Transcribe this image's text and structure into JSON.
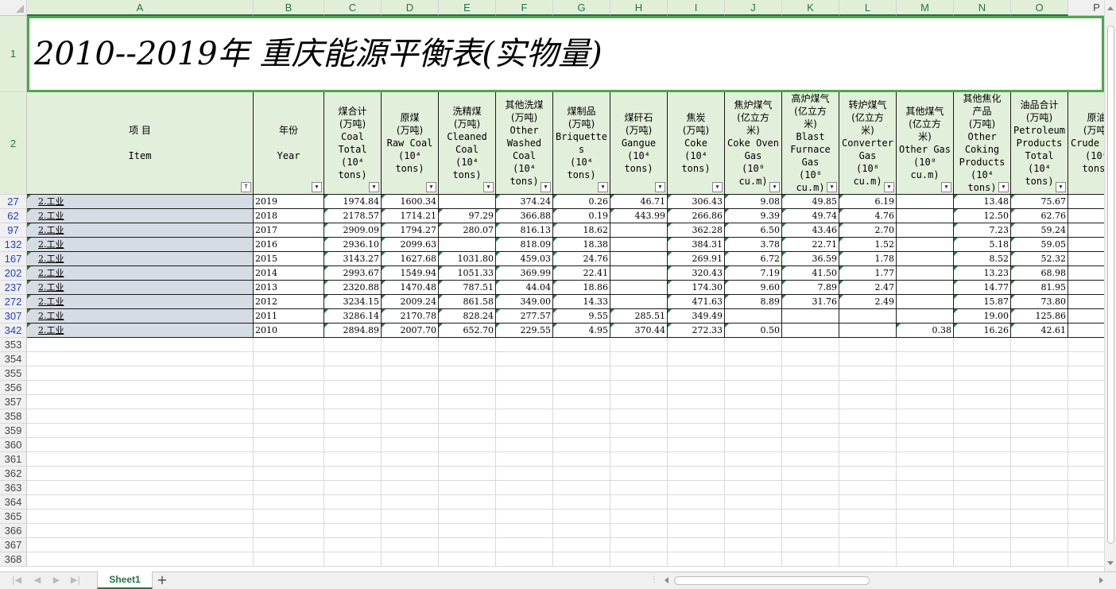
{
  "colors": {
    "accent": "#217346",
    "header_fill": "#e2efda",
    "item_fill": "#d6dce4",
    "filtered_row": "#1c3fd0",
    "title_border": "#4aa94a"
  },
  "columns": [
    "A",
    "B",
    "C",
    "D",
    "E",
    "F",
    "G",
    "H",
    "I",
    "J",
    "K",
    "L",
    "M",
    "N",
    "O",
    "P"
  ],
  "title": "2010--2019年  重庆能源平衡表(实物量)",
  "header_rows": {
    "title_row": "1",
    "header_row": "2"
  },
  "headers": [
    {
      "lines": [
        "项 目",
        "",
        "Item"
      ]
    },
    {
      "lines": [
        "年份",
        "",
        "Year"
      ]
    },
    {
      "lines": [
        "煤合计",
        "(万吨)",
        "Coal",
        "Total",
        "(10⁴",
        "tons)"
      ]
    },
    {
      "lines": [
        "原煤",
        "(万吨)",
        "Raw Coal",
        "(10⁴",
        "tons)"
      ]
    },
    {
      "lines": [
        "洗精煤",
        "(万吨)",
        "Cleaned",
        "Coal",
        "(10⁴",
        "tons)"
      ]
    },
    {
      "lines": [
        "其他洗煤",
        "(万吨)",
        "Other",
        "Washed",
        "Coal",
        "(10⁴",
        "tons)"
      ]
    },
    {
      "lines": [
        "煤制品",
        "(万吨)",
        "Briquette",
        "s",
        "(10⁴",
        "tons)"
      ]
    },
    {
      "lines": [
        "煤矸石",
        "(万吨)",
        "Gangue",
        "(10⁴",
        "tons)"
      ]
    },
    {
      "lines": [
        "焦炭",
        "(万吨)",
        "Coke",
        "(10⁴",
        "tons)"
      ]
    },
    {
      "lines": [
        "焦炉煤气",
        "(亿立方",
        "米)",
        "Coke Oven",
        "Gas",
        "(10⁸",
        "cu.m)"
      ]
    },
    {
      "lines": [
        "高炉煤气",
        "(亿立方",
        "米)",
        "Blast",
        "Furnace",
        "Gas",
        "(10⁸",
        "cu.m)"
      ]
    },
    {
      "lines": [
        "转炉煤气",
        "(亿立方",
        "米)",
        "Converter",
        "Gas",
        "(10⁸",
        "cu.m)"
      ]
    },
    {
      "lines": [
        "其他煤气",
        "(亿立方",
        "米)",
        "Other Gas",
        "(10⁸",
        "cu.m)"
      ]
    },
    {
      "lines": [
        "其他焦化",
        "产品",
        "(万吨)",
        "Other",
        "Coking",
        "Products",
        "(10⁴",
        "tons)"
      ]
    },
    {
      "lines": [
        "油品合计",
        "(万吨)",
        "Petroleum",
        "Products",
        "Total",
        "(10⁴",
        "tons)"
      ]
    },
    {
      "lines": [
        "原油",
        "(万吨)",
        "Crude Oil",
        "(10⁴",
        "tons)"
      ]
    }
  ],
  "rows": [
    {
      "num": "27",
      "item": "2.工业",
      "year": "2019",
      "vals": [
        "1974.84",
        "1600.34",
        "",
        "374.24",
        "0.26",
        "46.71",
        "306.43",
        "9.08",
        "49.85",
        "6.19",
        "",
        "13.48",
        "75.67"
      ]
    },
    {
      "num": "62",
      "item": "2.工业",
      "year": "2018",
      "vals": [
        "2178.57",
        "1714.21",
        "97.29",
        "366.88",
        "0.19",
        "443.99",
        "266.86",
        "9.39",
        "49.74",
        "4.76",
        "",
        "12.50",
        "62.76"
      ]
    },
    {
      "num": "97",
      "item": "2.工业",
      "year": "2017",
      "vals": [
        "2909.09",
        "1794.27",
        "280.07",
        "816.13",
        "18.62",
        "",
        "362.28",
        "6.50",
        "43.46",
        "2.70",
        "",
        "7.23",
        "59.24"
      ]
    },
    {
      "num": "132",
      "item": "2.工业",
      "year": "2016",
      "vals": [
        "2936.10",
        "2099.63",
        "",
        "818.09",
        "18.38",
        "",
        "384.31",
        "3.78",
        "22.71",
        "1.52",
        "",
        "5.18",
        "59.05"
      ]
    },
    {
      "num": "167",
      "item": "2.工业",
      "year": "2015",
      "vals": [
        "3143.27",
        "1627.68",
        "1031.80",
        "459.03",
        "24.76",
        "",
        "269.91",
        "6.72",
        "36.59",
        "1.78",
        "",
        "8.52",
        "52.32"
      ]
    },
    {
      "num": "202",
      "item": "2.工业",
      "year": "2014",
      "vals": [
        "2993.67",
        "1549.94",
        "1051.33",
        "369.99",
        "22.41",
        "",
        "320.43",
        "7.19",
        "41.50",
        "1.77",
        "",
        "13.23",
        "68.98"
      ]
    },
    {
      "num": "237",
      "item": "2.工业",
      "year": "2013",
      "vals": [
        "2320.88",
        "1470.48",
        "787.51",
        "44.04",
        "18.86",
        "",
        "174.30",
        "9.60",
        "7.89",
        "2.47",
        "",
        "14.77",
        "81.95"
      ]
    },
    {
      "num": "272",
      "item": "2.工业",
      "year": "2012",
      "vals": [
        "3234.15",
        "2009.24",
        "861.58",
        "349.00",
        "14.33",
        "",
        "471.63",
        "8.89",
        "31.76",
        "2.49",
        "",
        "15.87",
        "73.80"
      ]
    },
    {
      "num": "307",
      "item": "2.工业",
      "year": "2011",
      "vals": [
        "3286.14",
        "2170.78",
        "828.24",
        "277.57",
        "9.55",
        "285.51",
        "349.49",
        "",
        "",
        "",
        "",
        "19.00",
        "125.86"
      ]
    },
    {
      "num": "342",
      "item": "2.工业",
      "year": "2010",
      "vals": [
        "2894.89",
        "2007.70",
        "652.70",
        "229.55",
        "4.95",
        "370.44",
        "272.33",
        "0.50",
        "",
        "",
        "0.38",
        "16.26",
        "42.61"
      ]
    }
  ],
  "empty_rows": [
    "353",
    "354",
    "355",
    "356",
    "357",
    "358",
    "359",
    "360",
    "361",
    "362",
    "363",
    "364",
    "365",
    "366",
    "367",
    "368"
  ],
  "sheet_tab": "Sheet1",
  "add_sheet": "+",
  "filter_glyph": "▼",
  "filter_active_glyph": "T"
}
